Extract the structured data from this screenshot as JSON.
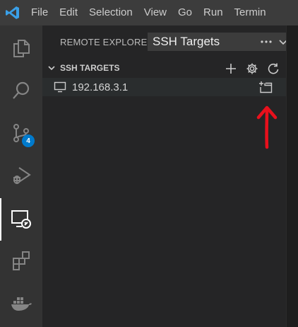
{
  "menubar": {
    "items": [
      "File",
      "Edit",
      "Selection",
      "View",
      "Go",
      "Run",
      "Termin"
    ]
  },
  "activity_bar": {
    "items": [
      {
        "name": "explorer-icon"
      },
      {
        "name": "search-icon"
      },
      {
        "name": "source-control-icon",
        "badge": "4"
      },
      {
        "name": "run-debug-icon"
      },
      {
        "name": "remote-explorer-icon",
        "active": true
      },
      {
        "name": "extensions-icon"
      },
      {
        "name": "docker-icon"
      }
    ]
  },
  "sidebar": {
    "title": "REMOTE EXPLORER",
    "target_select": "SSH Targets",
    "section": {
      "title": "SSH TARGETS",
      "actions": [
        "add-icon",
        "settings-gear-icon",
        "refresh-icon"
      ]
    },
    "hosts": [
      {
        "label": "192.168.3.1",
        "action": "open-in-new-window-icon"
      }
    ]
  },
  "colors": {
    "menubar_bg": "#3c3c3c",
    "activitybar_bg": "#333333",
    "sidebar_bg": "#252526",
    "badge": "#007acc",
    "annotation_arrow": "#e8101c",
    "vscode_logo": "#3aa0e8"
  }
}
